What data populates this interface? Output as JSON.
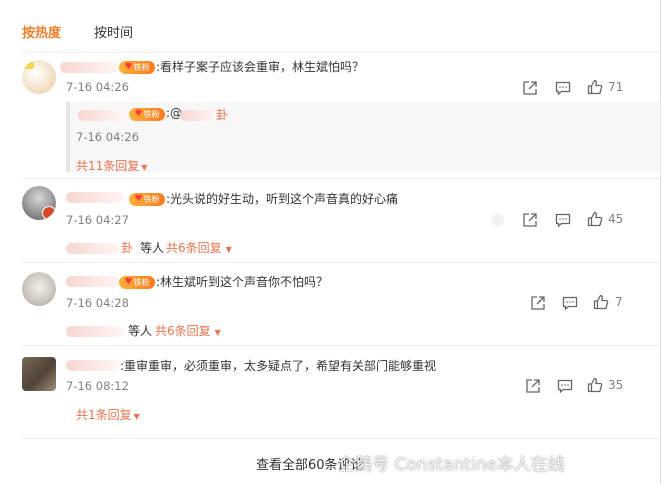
{
  "tabs": {
    "hot": "按热度",
    "time": "按时间"
  },
  "badge_text": "铁粉",
  "colors": {
    "accent": "#f27e2b",
    "link": "#eb7350",
    "time": "#808080"
  },
  "comments": [
    {
      "text": ":看样子案子应该会重审，林生斌怕吗？",
      "time": "7-16 04:26",
      "likes": "71",
      "reply": {
        "handle": ":@",
        "name_fragment": "卦",
        "time": "7-16 04:26"
      },
      "total_replies": "共11条回复"
    },
    {
      "text": ":光头说的好生动，听到这个声音真的好心痛",
      "time": "7-16 04:27",
      "likes": "45",
      "repliers_suffix": "卦",
      "etc": "等人",
      "total_replies": "共6条回复"
    },
    {
      "text": ":林生斌听到这个声音你不怕吗？",
      "time": "7-16 04:28",
      "likes": "7",
      "etc": "等人",
      "total_replies": "共6条回复"
    },
    {
      "text": ":重审重审，必须重审，太多疑点了，希望有关部门能够重视",
      "time": "7-16 08:12",
      "likes": "35",
      "total_replies": "共1条回复"
    }
  ],
  "footer": {
    "view_all": "查看全部60条评论"
  },
  "watermark": "企鹅号 Constantine本人在线",
  "icons": [
    "share-icon",
    "comment-icon",
    "like-icon",
    "chevron-down-icon",
    "heart-icon"
  ]
}
